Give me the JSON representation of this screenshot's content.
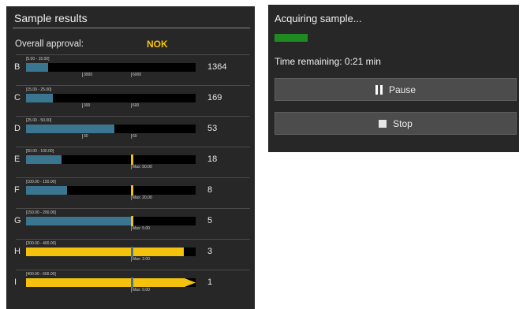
{
  "results": {
    "title": "Sample results",
    "approval_label": "Overall approval:",
    "approval_value": "NOK",
    "approval_color": "#f4c20d",
    "rows": [
      {
        "letter": "B",
        "range": "[5.00 - 15.00]",
        "count": "1364",
        "fill_color": "blue",
        "fill_fraction": 0.13,
        "limit_fraction": null,
        "limit_color": null,
        "ticks": [
          {
            "label": "3000",
            "fraction": 0.33
          },
          {
            "label": "6000",
            "fraction": 0.62
          }
        ]
      },
      {
        "letter": "C",
        "range": "[15.00 - 25.00]",
        "count": "169",
        "fill_color": "blue",
        "fill_fraction": 0.16,
        "limit_fraction": null,
        "limit_color": null,
        "ticks": [
          {
            "label": "300",
            "fraction": 0.33
          },
          {
            "label": "600",
            "fraction": 0.62
          }
        ]
      },
      {
        "letter": "D",
        "range": "[25.00 - 50.00]",
        "count": "53",
        "fill_color": "blue",
        "fill_fraction": 0.52,
        "limit_fraction": null,
        "limit_color": null,
        "ticks": [
          {
            "label": "30",
            "fraction": 0.33
          },
          {
            "label": "60",
            "fraction": 0.62
          }
        ]
      },
      {
        "letter": "E",
        "range": "[50.00 - 100.00]",
        "count": "18",
        "fill_color": "blue",
        "fill_fraction": 0.21,
        "limit_fraction": 0.62,
        "limit_color": "yellow",
        "ticks": [
          {
            "label": "Max: 50.00",
            "fraction": 0.62
          }
        ]
      },
      {
        "letter": "F",
        "range": "[100.00 - 150.00]",
        "count": "8",
        "fill_color": "blue",
        "fill_fraction": 0.24,
        "limit_fraction": 0.62,
        "limit_color": "yellow",
        "ticks": [
          {
            "label": "Max: 20.00",
            "fraction": 0.62
          }
        ]
      },
      {
        "letter": "G",
        "range": "[150.00 - 200.00]",
        "count": "5",
        "fill_color": "blue",
        "fill_fraction": 0.62,
        "limit_fraction": 0.62,
        "limit_color": "yellow",
        "ticks": [
          {
            "label": "Max: 5.00",
            "fraction": 0.62
          }
        ]
      },
      {
        "letter": "H",
        "range": "[200.00 - 400.00]",
        "count": "3",
        "fill_color": "yellow",
        "fill_fraction": 0.93,
        "limit_fraction": 0.62,
        "limit_color": "blue",
        "ticks": [
          {
            "label": "Max: 2.00",
            "fraction": 0.62
          }
        ]
      },
      {
        "letter": "I",
        "range": "[400.00 - 600.00]",
        "count": "1",
        "fill_color": "yellow-arrow",
        "fill_fraction": 1.0,
        "limit_fraction": 0.62,
        "limit_color": "blue",
        "ticks": [
          {
            "label": "Max: 0.00",
            "fraction": 0.62
          }
        ]
      }
    ]
  },
  "acquisition": {
    "title": "Acquiring sample...",
    "progress": 0.14,
    "progress_color": "#1f8a1f",
    "time_remaining": "Time remaining: 0:21 min",
    "pause_label": "Pause",
    "pause_icon": "pause-icon",
    "stop_label": "Stop",
    "stop_icon": "stop-icon"
  }
}
